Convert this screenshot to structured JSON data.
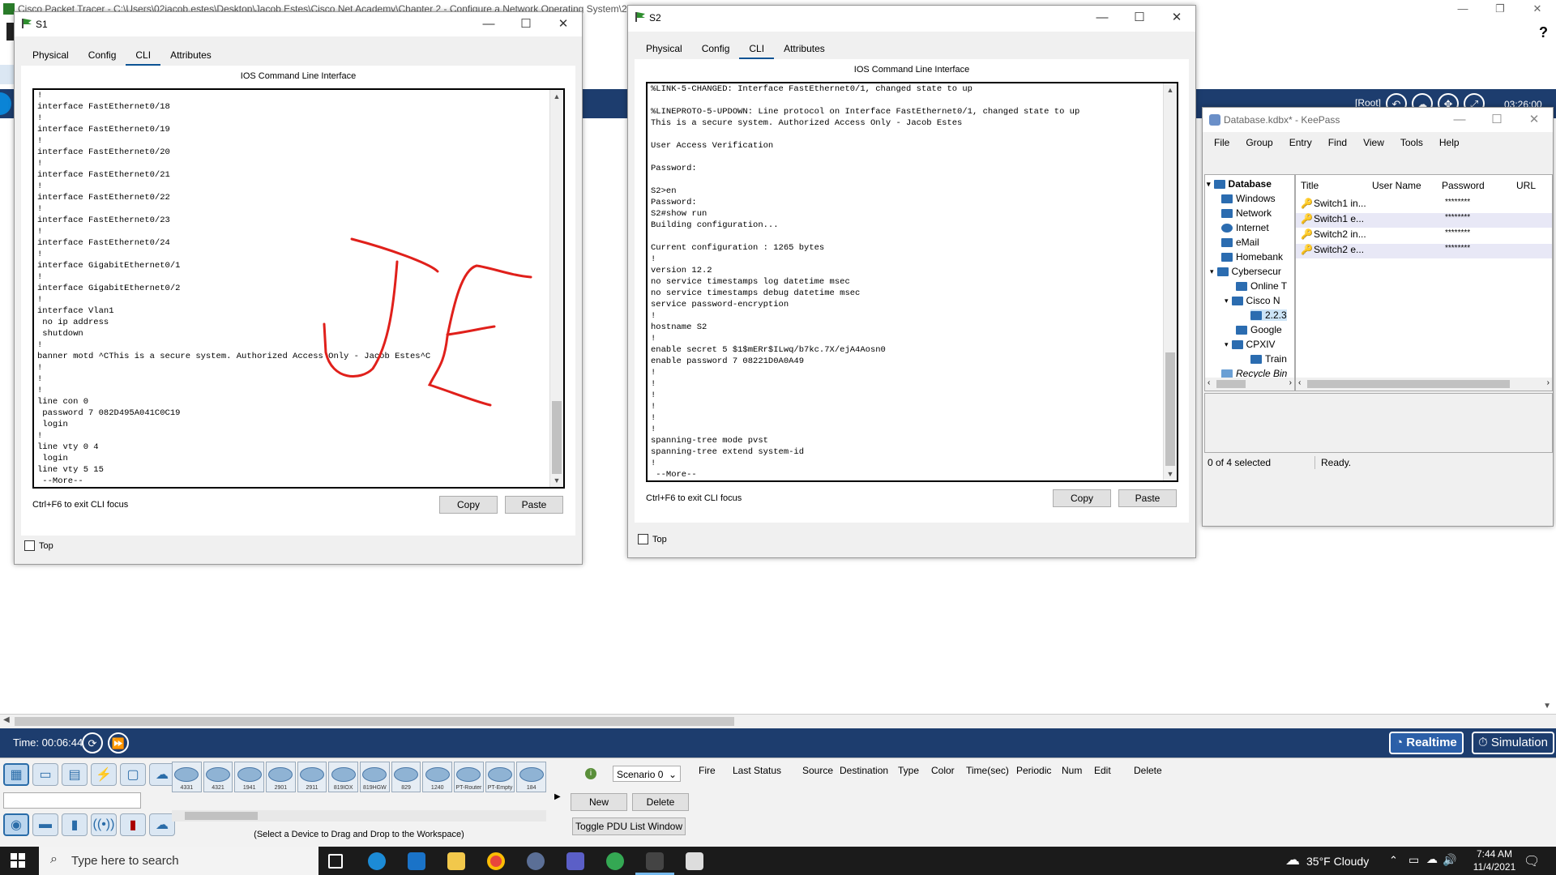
{
  "app": {
    "title": "Cisco Packet Tracer - C:\\Users\\02jacob.estes\\Desktop\\Jacob Estes\\Cisco Net Academy\\Chapter 2 - Configure a Network Operating System\\2.2.3",
    "time_label": "Time: 00:06:44",
    "realtime_label": "Realtime",
    "simulation_label": "Simulation",
    "root_label": "[Root]",
    "clock_overlay": "03:26:00",
    "device_models": [
      "4331",
      "4321",
      "1941",
      "2901",
      "2911",
      "819IOX",
      "819HGW",
      "829",
      "1240",
      "PT-Router",
      "PT-Empty",
      "184"
    ],
    "device_hint": "(Select a Device to Drag and Drop to the Workspace)",
    "scenario": "Scenario 0",
    "new_label": "New",
    "delete_label": "Delete",
    "toggle_pdu_label": "Toggle PDU List Window",
    "pdu_columns": [
      "Fire",
      "Last Status",
      "Source",
      "Destination",
      "Type",
      "Color",
      "Time(sec)",
      "Periodic",
      "Num",
      "Edit",
      "Delete"
    ]
  },
  "s1": {
    "title": "S1",
    "tabs": [
      "Physical",
      "Config",
      "CLI",
      "Attributes"
    ],
    "heading": "IOS Command Line Interface",
    "cli": "!\ninterface FastEthernet0/18\n!\ninterface FastEthernet0/19\n!\ninterface FastEthernet0/20\n!\ninterface FastEthernet0/21\n!\ninterface FastEthernet0/22\n!\ninterface FastEthernet0/23\n!\ninterface FastEthernet0/24\n!\ninterface GigabitEthernet0/1\n!\ninterface GigabitEthernet0/2\n!\ninterface Vlan1\n no ip address\n shutdown\n!\nbanner motd ^CThis is a secure system. Authorized Access Only - Jacob Estes^C\n!\n!\n!\nline con 0\n password 7 082D495A041C0C19\n login\n!\nline vty 0 4\n login\nline vty 5 15\n --More--",
    "hint": "Ctrl+F6 to exit CLI focus",
    "copy": "Copy",
    "paste": "Paste",
    "top": "Top"
  },
  "s2": {
    "title": "S2",
    "tabs": [
      "Physical",
      "Config",
      "CLI",
      "Attributes"
    ],
    "heading": "IOS Command Line Interface",
    "cli": "%LINK-5-CHANGED: Interface FastEthernet0/1, changed state to up\n\n%LINEPROTO-5-UPDOWN: Line protocol on Interface FastEthernet0/1, changed state to up\nThis is a secure system. Authorized Access Only - Jacob Estes\n\nUser Access Verification\n\nPassword:\n\nS2>en\nPassword:\nS2#show run\nBuilding configuration...\n\nCurrent configuration : 1265 bytes\n!\nversion 12.2\nno service timestamps log datetime msec\nno service timestamps debug datetime msec\nservice password-encryption\n!\nhostname S2\n!\nenable secret 5 $1$mERr$ILwq/b7kc.7X/ejA4Aosn0\nenable password 7 08221D0A0A49\n!\n!\n!\n!\n!\n!\nspanning-tree mode pvst\nspanning-tree extend system-id\n!\n --More-- ",
    "hint": "Ctrl+F6 to exit CLI focus",
    "copy": "Copy",
    "paste": "Paste",
    "top": "Top"
  },
  "keepass": {
    "title": "Database.kdbx* - KeePass",
    "menu": [
      "File",
      "Group",
      "Entry",
      "Find",
      "View",
      "Tools",
      "Help"
    ],
    "tree": [
      {
        "label": "Database",
        "level": 0,
        "expand": "v"
      },
      {
        "label": "Windows",
        "level": 1
      },
      {
        "label": "Network",
        "level": 1
      },
      {
        "label": "Internet",
        "level": 1
      },
      {
        "label": "eMail",
        "level": 1
      },
      {
        "label": "Homebank",
        "level": 1
      },
      {
        "label": "Cybersecur",
        "level": 1,
        "expand": "v"
      },
      {
        "label": "Online T",
        "level": 2
      },
      {
        "label": "Cisco N",
        "level": 2,
        "expand": "v"
      },
      {
        "label": "2.2.3",
        "level": 3
      },
      {
        "label": "Google",
        "level": 2
      },
      {
        "label": "CPXIV",
        "level": 2,
        "expand": "v"
      },
      {
        "label": "Train",
        "level": 3
      },
      {
        "label": "Recycle Bin",
        "level": 1
      }
    ],
    "columns": [
      "Title",
      "User Name",
      "Password",
      "URL"
    ],
    "entries": [
      {
        "title": "Switch1 in...",
        "password": "********"
      },
      {
        "title": "Switch1 e...",
        "password": "********"
      },
      {
        "title": "Switch2 in...",
        "password": "********"
      },
      {
        "title": "Switch2 e...",
        "password": "********"
      }
    ],
    "status_selected": "0 of 4 selected",
    "status_ready": "Ready."
  },
  "taskbar": {
    "search_placeholder": "Type here to search",
    "weather": "35°F  Cloudy",
    "time": "7:44 AM",
    "date": "11/4/2021"
  },
  "colors": {
    "pt_blue": "#1d3d6e",
    "annotation_red": "#e0201b",
    "taskbar": "#1b1b1b"
  }
}
